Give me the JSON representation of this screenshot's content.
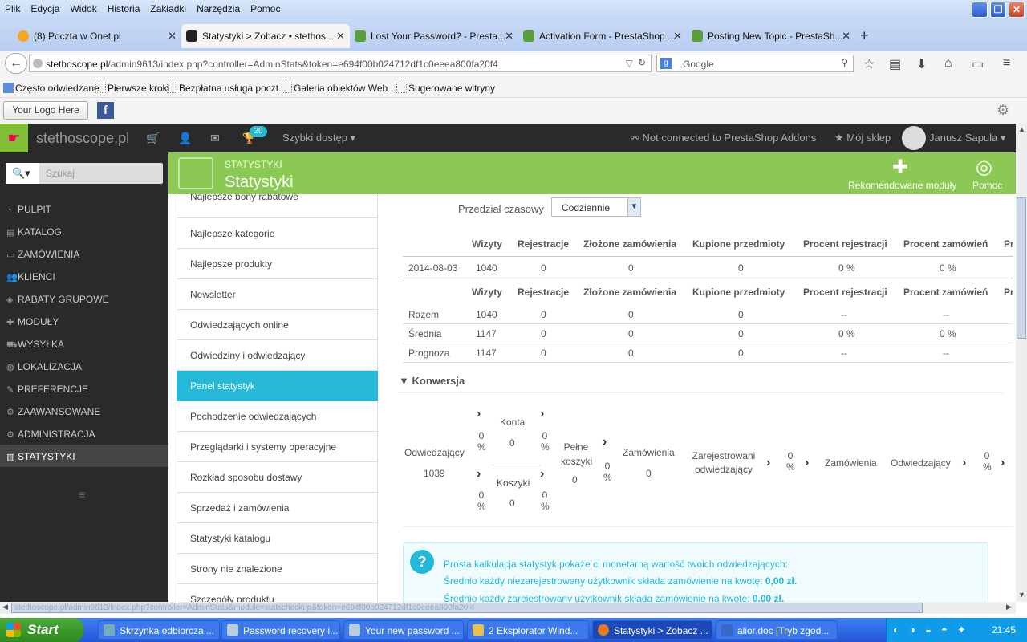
{
  "browser": {
    "menu": [
      "Plik",
      "Edycja",
      "Widok",
      "Historia",
      "Zakładki",
      "Narzędzia",
      "Pomoc"
    ],
    "tabs": [
      {
        "title": "(8) Poczta w Onet.pl",
        "icon": "onet-icon"
      },
      {
        "title": "Statystyki > Zobacz • stethos...",
        "icon": "prestashop-icon"
      },
      {
        "title": "Lost Your Password? - Presta...",
        "icon": "prestashop-icon"
      },
      {
        "title": "Activation Form - PrestaShop ...",
        "icon": "prestashop-icon"
      },
      {
        "title": "Posting New Topic - PrestaSh...",
        "icon": "prestashop-icon"
      }
    ],
    "url_domain": "stethoscope.pl",
    "url_rest": "/admin9613/index.php?controller=AdminStats&token=e694f00b024712df1c0eeea800fa20f4",
    "search_placeholder": "Google",
    "bookmarks": [
      "Często odwiedzane",
      "Pierwsze kroki",
      "Bezpłatna usługa poczt...",
      "Galeria obiektów Web ...",
      "Sugerowane witryny"
    ],
    "logo_button": "Your Logo Here",
    "fb_label": "f"
  },
  "header": {
    "shop_name": "stethoscope.pl",
    "notif_count": "20",
    "quick_access": "Szybki dostęp",
    "addons": "Not connected to PrestaShop Addons",
    "my_shop": "Mój sklep",
    "user": "Janusz Sapula"
  },
  "sidebar": {
    "search_placeholder": "Szukaj",
    "items": [
      {
        "label": "PULPIT",
        "icon": "dashboard-icon"
      },
      {
        "label": "KATALOG",
        "icon": "catalog-icon"
      },
      {
        "label": "ZAMÓWIENIA",
        "icon": "orders-icon"
      },
      {
        "label": "KLIENCI",
        "icon": "users-icon"
      },
      {
        "label": "RABATY GRUPOWE",
        "icon": "tag-icon"
      },
      {
        "label": "MODUŁY",
        "icon": "puzzle-icon"
      },
      {
        "label": "WYSYŁKA",
        "icon": "truck-icon"
      },
      {
        "label": "LOKALIZACJA",
        "icon": "globe-icon"
      },
      {
        "label": "PREFERENCJE",
        "icon": "wrench-icon"
      },
      {
        "label": "ZAAWANSOWANE",
        "icon": "cogs-icon"
      },
      {
        "label": "ADMINISTRACJA",
        "icon": "gear-icon"
      },
      {
        "label": "STATYSTYKI",
        "icon": "chart-icon"
      }
    ]
  },
  "page": {
    "breadcrumb": "STATYSTYKI",
    "title": "Statystyki",
    "btn_modules": "Rekomendowane moduły",
    "btn_help": "Pomoc"
  },
  "stats_menu": [
    "Najlepsze bony rabatowe",
    "Najlepsze kategorie",
    "Najlepsze produkty",
    "Newsletter",
    "Odwiedzających online",
    "Odwiedziny i odwiedzający",
    "Panel statystyk",
    "Pochodzenie odwiedzających",
    "Przeglądarki i systemy operacyjne",
    "Rozkład sposobu dostawy",
    "Sprzedaż i zamówienia",
    "Statystyki katalogu",
    "Strony nie znalezione",
    "Szczegóły produktu"
  ],
  "panel": {
    "range_label": "Przedział czasowy",
    "range_value": "Codziennie",
    "columns": [
      "Wizyty",
      "Rejestracje",
      "Złożone zamówienia",
      "Kupione przedmioty",
      "Procent rejestracji",
      "Procent zamówień",
      "Pr"
    ],
    "rows": [
      {
        "label": "2014-08-03",
        "values": [
          "1040",
          "0",
          "0",
          "0",
          "0 %",
          "0 %"
        ]
      }
    ],
    "summary": [
      {
        "label": "Razem",
        "values": [
          "1040",
          "0",
          "0",
          "0",
          "--",
          "--"
        ]
      },
      {
        "label": "Średnia",
        "values": [
          "1147",
          "0",
          "0",
          "0",
          "0 %",
          "0 %"
        ]
      },
      {
        "label": "Prognoza",
        "values": [
          "1147",
          "0",
          "0",
          "0",
          "--",
          "--"
        ]
      }
    ],
    "conversion_title": "Konwersja",
    "conversion": {
      "visitors_label": "Odwiedzający",
      "visitors_value": "1039",
      "accounts_label": "Konta",
      "accounts_value": "0",
      "carts_label": "Koszyki",
      "carts_value": "0",
      "full_carts_label": "Pełne koszyki",
      "full_carts_value": "0",
      "orders_label": "Zamówienia",
      "orders_value": "0",
      "registered_label": "Zarejestrowani odwiedzający",
      "orders2_label": "Zamówienia",
      "visitors2_label": "Odwiedzający",
      "pct": "0",
      "pct_sign": "%"
    },
    "info_line1": "Prosta kalkulacja statystyk pokaże ci monetarną wartość twoich odwiedzających:",
    "info_line2_prefix": "Średnio każdy niezarejestrowany użytkownik składa zamówienie na kwotę:",
    "info_line2_value": "0,00 zł.",
    "info_line3_prefix": "Średnio każdy zarejestrowany użytkownik składa zamówienie na kwotę:",
    "info_line3_value": "0,00 zł."
  },
  "status_url": "stethoscope.pl/admin9613/index.php?controller=AdminStats&module=statscheckup&token=e694f00b024712df1c0eeea800fa20f4",
  "taskbar": {
    "start": "Start",
    "items": [
      "Skrzynka odbiorcza ...",
      "Password recovery i...",
      "Your new password ...",
      "2 Eksplorator Wind...",
      "Statystyki > Zobacz ...",
      "alior.doc [Tryb zgod..."
    ],
    "clock": "21:45"
  }
}
